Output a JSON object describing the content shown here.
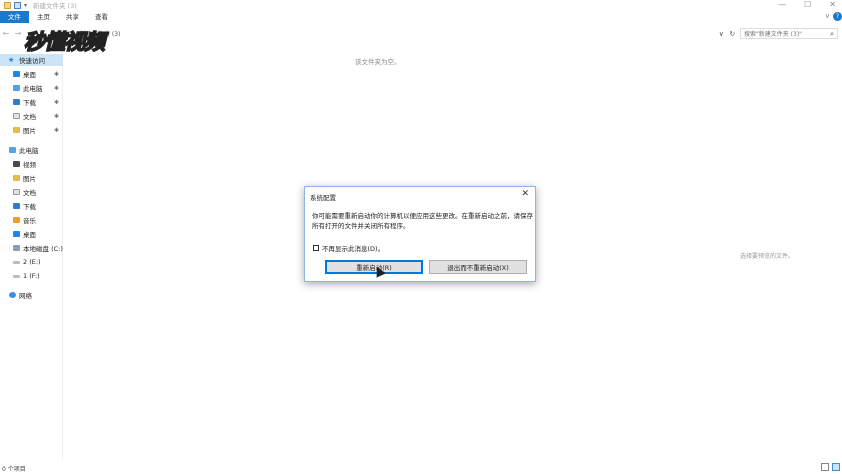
{
  "window": {
    "title": "新建文件夹 (3)",
    "minimize": "—",
    "maximize": "☐",
    "close": "✕"
  },
  "ribbon": {
    "tabs": [
      "文件",
      "主页",
      "共享",
      "查看"
    ],
    "expand": "∨",
    "help": "?"
  },
  "address": {
    "path": "新建文件夹 (3)",
    "dropdown": "∨",
    "refresh": "↻",
    "search_placeholder": "搜索\"新建文件夹 (3)\""
  },
  "watermark": {
    "text": "秒懂视频"
  },
  "sidebar": {
    "quick_access": "快速访问",
    "quick_items": [
      "桌面",
      "此电脑",
      "下载",
      "文档",
      "图片"
    ],
    "this_pc": "此电脑",
    "pc_items": [
      "视频",
      "图片",
      "文档",
      "下载",
      "音乐",
      "桌面",
      "本地磁盘 (C:)",
      "2 (E:)",
      "1 (F:)"
    ],
    "network": "网络"
  },
  "content": {
    "empty_message": "该文件夹为空。",
    "preview_message": "选择要预览的文件。"
  },
  "dialog": {
    "title": "系统配置",
    "message": "你可能需要重新启动你的计算机以便应用这些更改。在重新启动之前，请保存所有打开的文件并关闭所有程序。",
    "checkbox_label": "不再显示此消息(D)。",
    "restart_button": "重新启动(R)",
    "exit_button": "退出而不重新启动(X)"
  },
  "status": {
    "item_count": "0 个项目"
  }
}
